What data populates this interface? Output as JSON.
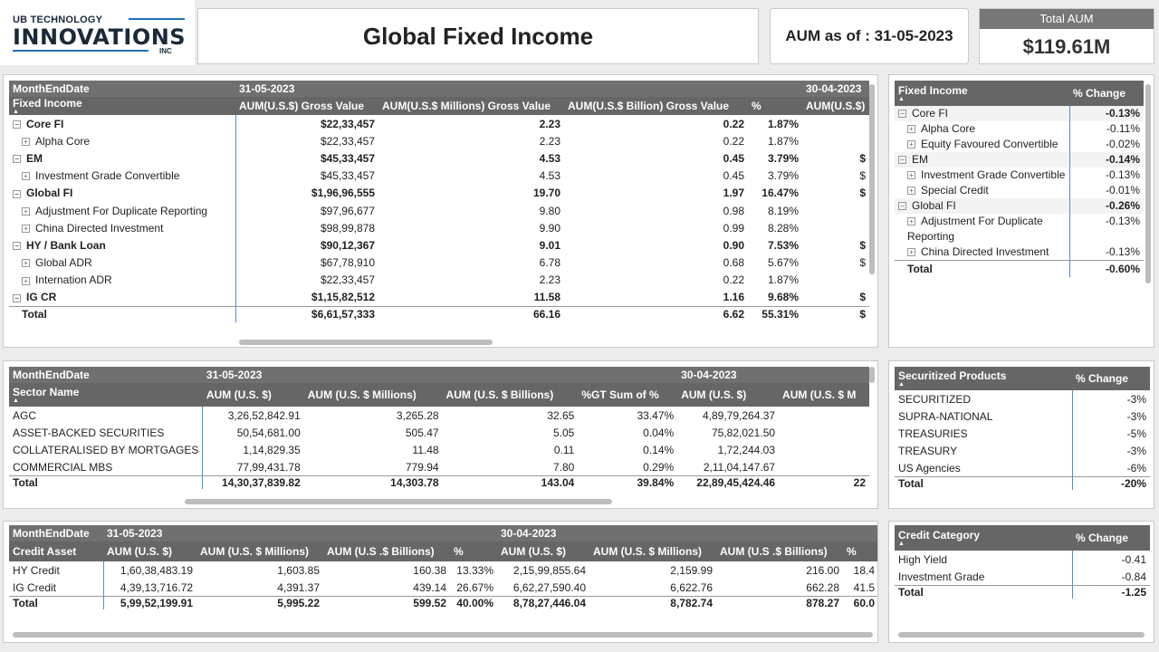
{
  "header": {
    "logo_line1": "UB TECHNOLOGY",
    "logo_line2": "INNOVATIONS",
    "logo_line3": "INC",
    "title": "Global Fixed Income",
    "aum_as_of": "AUM as of : 31-05-2023",
    "total_aum_label": "Total AUM",
    "total_aum_value": "$119.61M"
  },
  "fi_table": {
    "month_label": "MonthEndDate",
    "date1": "31-05-2023",
    "date2": "30-04-2023",
    "row_header": "Fixed Income",
    "columns": [
      "AUM(U.S.$) Gross Value",
      "AUM(U.S.$ Millions) Gross Value",
      "AUM(U.S.$ Billion) Gross Value",
      "%",
      "AUM(U.S.$)"
    ],
    "rows": [
      {
        "name": "Core FI",
        "level": 0,
        "v1": "$22,33,457",
        "v2": "2.23",
        "v3": "0.22",
        "pct": "1.87%",
        "next": ""
      },
      {
        "name": "Alpha Core",
        "level": 1,
        "v1": "$22,33,457",
        "v2": "2.23",
        "v3": "0.22",
        "pct": "1.87%",
        "next": ""
      },
      {
        "name": "EM",
        "level": 0,
        "v1": "$45,33,457",
        "v2": "4.53",
        "v3": "0.45",
        "pct": "3.79%",
        "next": "$"
      },
      {
        "name": "Investment Grade Convertible",
        "level": 1,
        "v1": "$45,33,457",
        "v2": "4.53",
        "v3": "0.45",
        "pct": "3.79%",
        "next": "$"
      },
      {
        "name": "Global FI",
        "level": 0,
        "v1": "$1,96,96,555",
        "v2": "19.70",
        "v3": "1.97",
        "pct": "16.47%",
        "next": "$"
      },
      {
        "name": "Adjustment For Duplicate Reporting",
        "level": 1,
        "v1": "$97,96,677",
        "v2": "9.80",
        "v3": "0.98",
        "pct": "8.19%",
        "next": ""
      },
      {
        "name": "China Directed Investment",
        "level": 1,
        "v1": "$98,99,878",
        "v2": "9.90",
        "v3": "0.99",
        "pct": "8.28%",
        "next": ""
      },
      {
        "name": "HY / Bank Loan",
        "level": 0,
        "v1": "$90,12,367",
        "v2": "9.01",
        "v3": "0.90",
        "pct": "7.53%",
        "next": "$"
      },
      {
        "name": "Global ADR",
        "level": 1,
        "v1": "$67,78,910",
        "v2": "6.78",
        "v3": "0.68",
        "pct": "5.67%",
        "next": "$"
      },
      {
        "name": "Internation ADR",
        "level": 1,
        "v1": "$22,33,457",
        "v2": "2.23",
        "v3": "0.22",
        "pct": "1.87%",
        "next": ""
      },
      {
        "name": "IG CR",
        "level": 0,
        "v1": "$1,15,82,512",
        "v2": "11.58",
        "v3": "1.16",
        "pct": "9.68%",
        "next": "$"
      }
    ],
    "total": {
      "name": "Total",
      "v1": "$6,61,57,333",
      "v2": "66.16",
      "v3": "6.62",
      "pct": "55.31%",
      "next": "$"
    }
  },
  "fi_change": {
    "col1": "Fixed Income",
    "col2": "% Change",
    "rows": [
      {
        "name": "Core FI",
        "level": 0,
        "val": "-0.13%"
      },
      {
        "name": "Alpha Core",
        "level": 1,
        "val": "-0.11%"
      },
      {
        "name": "Equity Favoured Convertible",
        "level": 1,
        "val": "-0.02%"
      },
      {
        "name": "EM",
        "level": 0,
        "val": "-0.14%"
      },
      {
        "name": "Investment Grade Convertible",
        "level": 1,
        "val": "-0.13%"
      },
      {
        "name": "Special Credit",
        "level": 1,
        "val": "-0.01%"
      },
      {
        "name": "Global FI",
        "level": 0,
        "val": "-0.26%"
      },
      {
        "name": "Adjustment For Duplicate Reporting",
        "level": 1,
        "val": "-0.13%"
      },
      {
        "name": "China Directed Investment",
        "level": 1,
        "val": "-0.13%"
      }
    ],
    "total": {
      "name": "Total",
      "val": "-0.60%"
    }
  },
  "sector_table": {
    "month_label": "MonthEndDate",
    "date1": "31-05-2023",
    "date2": "30-04-2023",
    "row_header": "Sector Name",
    "columns": [
      "AUM (U.S. $)",
      "AUM (U.S. $ Millions)",
      "AUM (U.S. $ Billions)",
      "%GT Sum of %",
      "AUM (U.S. $)",
      "AUM (U.S. $ M"
    ],
    "rows": [
      {
        "name": "AGC",
        "c1": "3,26,52,842.91",
        "c2": "3,265.28",
        "c3": "32.65",
        "c4": "33.47%",
        "c5": "4,89,79,264.37"
      },
      {
        "name": "ASSET-BACKED SECURITIES",
        "c1": "50,54,681.00",
        "c2": "505.47",
        "c3": "5.05",
        "c4": "0.04%",
        "c5": "75,82,021.50"
      },
      {
        "name": "COLLATERALISED BY MORTGAGES",
        "c1": "1,14,829.35",
        "c2": "11.48",
        "c3": "0.11",
        "c4": "0.14%",
        "c5": "1,72,244.03"
      },
      {
        "name": "COMMERCIAL MBS",
        "c1": "77,99,431.78",
        "c2": "779.94",
        "c3": "7.80",
        "c4": "0.29%",
        "c5": "2,11,04,147.67"
      }
    ],
    "total": {
      "name": "Total",
      "c1": "14,30,37,839.82",
      "c2": "14,303.78",
      "c3": "143.04",
      "c4": "39.84%",
      "c5": "22,89,45,424.46",
      "c6": "22"
    }
  },
  "securitized": {
    "col1": "Securitized Products",
    "col2": "% Change",
    "rows": [
      {
        "name": "SECURITIZED",
        "val": "-3%"
      },
      {
        "name": "SUPRA-NATIONAL",
        "val": "-3%"
      },
      {
        "name": "TREASURIES",
        "val": "-5%"
      },
      {
        "name": "TREASURY",
        "val": "-3%"
      },
      {
        "name": "US Agencies",
        "val": "-6%"
      }
    ],
    "total": {
      "name": "Total",
      "val": "-20%"
    }
  },
  "credit_table": {
    "month_label": "MonthEndDate",
    "date1": "31-05-2023",
    "date2": "30-04-2023",
    "row_header": "Credit Asset",
    "columns": [
      "AUM (U.S. $)",
      "AUM (U.S. $ Millions)",
      "AUM (U.S .$ Billions)",
      "%",
      "AUM (U.S. $)",
      "AUM (U.S. $ Millions)",
      "AUM (U.S .$ Billions)",
      "%"
    ],
    "rows": [
      {
        "name": "HY Credit",
        "c1": "1,60,38,483.19",
        "c2": "1,603.85",
        "c3": "160.38",
        "c4": "13.33%",
        "c5": "2,15,99,855.64",
        "c6": "2,159.99",
        "c7": "216.00",
        "c8": "18.4"
      },
      {
        "name": "IG Credit",
        "c1": "4,39,13,716.72",
        "c2": "4,391.37",
        "c3": "439.14",
        "c4": "26.67%",
        "c5": "6,62,27,590.40",
        "c6": "6,622.76",
        "c7": "662.28",
        "c8": "41.5"
      }
    ],
    "total": {
      "name": "Total",
      "c1": "5,99,52,199.91",
      "c2": "5,995.22",
      "c3": "599.52",
      "c4": "40.00%",
      "c5": "8,78,27,446.04",
      "c6": "8,782.74",
      "c7": "878.27",
      "c8": "60.0"
    }
  },
  "credit_category": {
    "col1": "Credit Category",
    "col2": "% Change",
    "rows": [
      {
        "name": "High Yield",
        "val": "-0.41"
      },
      {
        "name": "Investment Grade",
        "val": "-0.84"
      }
    ],
    "total": {
      "name": "Total",
      "val": "-1.25"
    }
  }
}
